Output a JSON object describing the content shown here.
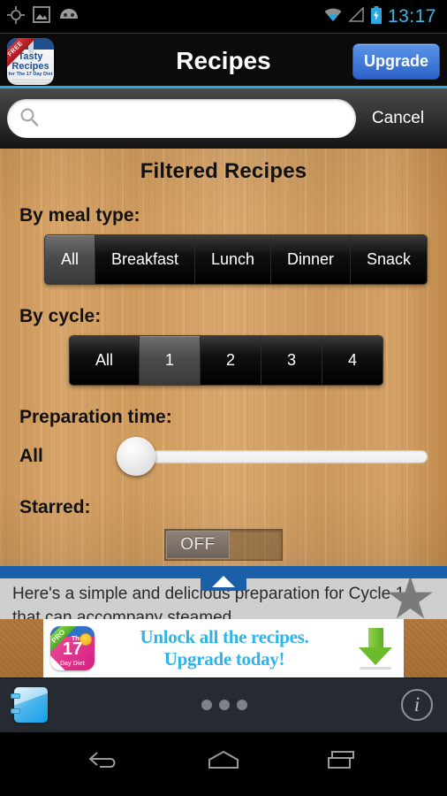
{
  "status_bar": {
    "time": "13:17",
    "left_icons": [
      "location-crosshair-icon",
      "screenshot-image-icon",
      "android-head-icon"
    ],
    "right_icons": [
      "wifi-icon",
      "signal-icon",
      "battery-charging-icon"
    ],
    "time_color": "#3bb9e8"
  },
  "action_bar": {
    "title": "Recipes",
    "upgrade_label": "Upgrade",
    "app_icon": {
      "ribbon": "FREE",
      "line1": "Tasty",
      "line2": "Recipes",
      "line3": "for The 17 Day Diet"
    },
    "accent_color": "#2aa8e0"
  },
  "search": {
    "value": "",
    "placeholder": "",
    "cancel_label": "Cancel"
  },
  "filters": {
    "panel_title": "Filtered Recipes",
    "meal_type": {
      "label": "By meal type:",
      "options": [
        "All",
        "Breakfast",
        "Lunch",
        "Dinner",
        "Snack"
      ],
      "selected": "All"
    },
    "cycle": {
      "label": "By cycle:",
      "options": [
        "All",
        "1",
        "2",
        "3",
        "4"
      ],
      "selected": "1"
    },
    "prep_time": {
      "label": "Preparation time:",
      "value": "All",
      "slider_position_percent": 0
    },
    "starred": {
      "label": "Starred:",
      "state": "OFF"
    }
  },
  "result_row": {
    "text": "Here's a simple and delicious preparation for Cycle 1 that can accompany steamed",
    "header_color": "#1b5fa8",
    "star_state": "unstarred"
  },
  "ad": {
    "line1": "Unlock all the recipes.",
    "line2": "Upgrade today!",
    "icon": {
      "badge": "PRO",
      "the": "The",
      "number": "17",
      "subtitle": "Day Diet"
    },
    "text_color": "#2fb4e8"
  },
  "bottom_bar": {
    "notebook_label": "notebook-icon",
    "dots_count": 3,
    "info_label": "i"
  },
  "nav_bar": {
    "buttons": [
      "back-icon",
      "home-icon",
      "recents-icon"
    ]
  }
}
